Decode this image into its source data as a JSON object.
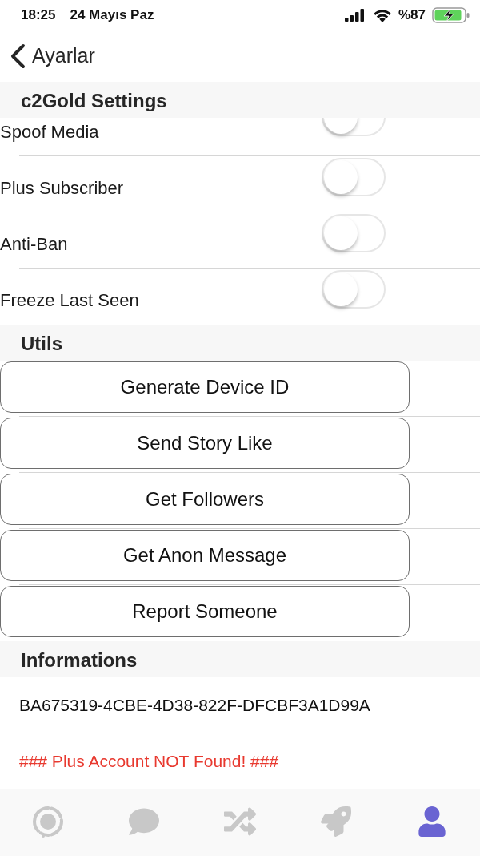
{
  "status_bar": {
    "time": "18:25",
    "date": "24 Mayıs Paz",
    "battery": "%87"
  },
  "nav": {
    "back_label": "Ayarlar"
  },
  "sections": [
    {
      "title": "c2Gold Settings",
      "kind": "toggles",
      "items": [
        {
          "label": "Spoof Media",
          "on": false
        },
        {
          "label": "Plus Subscriber",
          "on": false
        },
        {
          "label": "Anti-Ban",
          "on": false
        },
        {
          "label": "Freeze Last Seen",
          "on": false
        }
      ]
    },
    {
      "title": "Utils",
      "kind": "buttons",
      "items": [
        {
          "label": "Generate Device ID"
        },
        {
          "label": "Send Story Like"
        },
        {
          "label": "Get Followers"
        },
        {
          "label": "Get Anon Message"
        },
        {
          "label": "Report Someone"
        }
      ]
    },
    {
      "title": "Informations",
      "kind": "info",
      "items": [
        {
          "kind": "plain",
          "text": "BA675319-4CBE-4D38-822F-DFCBF3A1D99A"
        },
        {
          "kind": "warning",
          "text": "### Plus Account NOT Found! ###"
        }
      ]
    }
  ],
  "tab_bar": [
    {
      "kind": "stories",
      "selected": false
    },
    {
      "kind": "chats",
      "selected": false
    },
    {
      "kind": "shuffle",
      "selected": false
    },
    {
      "kind": "rocket",
      "selected": false
    },
    {
      "kind": "profile",
      "selected": true
    }
  ]
}
